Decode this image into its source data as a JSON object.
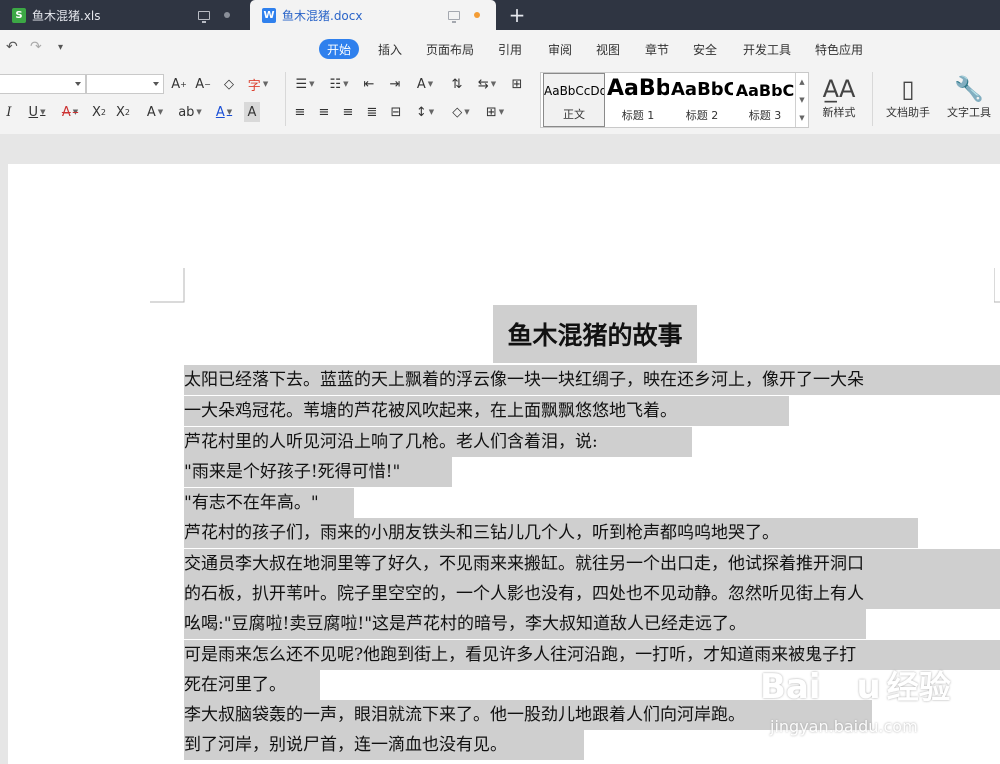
{
  "tabs": [
    {
      "label": "鱼木混猪.xls",
      "icon": "spreadsheet-icon",
      "icon_letter": "S",
      "icon_color": "#3ca845",
      "active": false,
      "status_dot": "#8a8f99"
    },
    {
      "label": "鱼木混猪.docx",
      "icon": "writer-doc-icon",
      "icon_letter": "W",
      "icon_color": "#2f80ed",
      "active": true,
      "status_dot": "#f39c34"
    }
  ],
  "new_tab_label": "+",
  "quick_access": {
    "undo": "↶",
    "redo": "↷",
    "more": "▾"
  },
  "menu": [
    "开始",
    "插入",
    "页面布局",
    "引用",
    "审阅",
    "视图",
    "章节",
    "安全",
    "开发工具",
    "特色应用"
  ],
  "menu_active": "开始",
  "toolbar": {
    "font_name": "",
    "font_size": "",
    "styles": [
      {
        "sample": "AaBbCcDd",
        "label": "正文"
      },
      {
        "sample": "AaBb",
        "label": "标题 1"
      },
      {
        "sample": "AaBbC",
        "label": "标题 2"
      },
      {
        "sample": "AaBbC",
        "label": "标题 3"
      }
    ],
    "new_style_label": "新样式",
    "doc_assistant_label": "文档助手",
    "text_tools_label": "文字工具"
  },
  "document": {
    "title": "鱼木混猪的故事",
    "lines": [
      "太阳已经落下去。蓝蓝的天上飘着的浮云像一块一块红绸子，映在还乡河上，像开了一大朵",
      "一大朵鸡冠花。苇塘的芦花被风吹起来，在上面飘飘悠悠地飞着。",
      "芦花村里的人听见河沿上响了几枪。老人们含着泪，说:",
      "\"雨来是个好孩子!死得可惜!\"",
      "\"有志不在年高。\"",
      "芦花村的孩子们，雨来的小朋友铁头和三钻儿几个人，听到枪声都呜呜地哭了。",
      "交通员李大叔在地洞里等了好久，不见雨来来搬缸。就往另一个出口走，他试探着推开洞口",
      "的石板，扒开苇叶。院子里空空的，一个人影也没有，四处也不见动静。忽然听见街上有人",
      "吆喝:\"豆腐啦!卖豆腐啦!\"这是芦花村的暗号，李大叔知道敌人已经走远了。",
      "可是雨来怎么还不见呢?他跑到街上，看见许多人往河沿跑，一打听，才知道雨来被鬼子打",
      "死在河里了。",
      "李大叔脑袋轰的一声，眼泪就流下来了。他一股劲儿地跟着人们向河岸跑。",
      "到了河岸，别说尸首，连一滴血也没有见。"
    ]
  },
  "watermark": {
    "brand": "Bai",
    "brand_tail": "u",
    "cn": "经验",
    "site": "jingyan.baidu.com"
  }
}
